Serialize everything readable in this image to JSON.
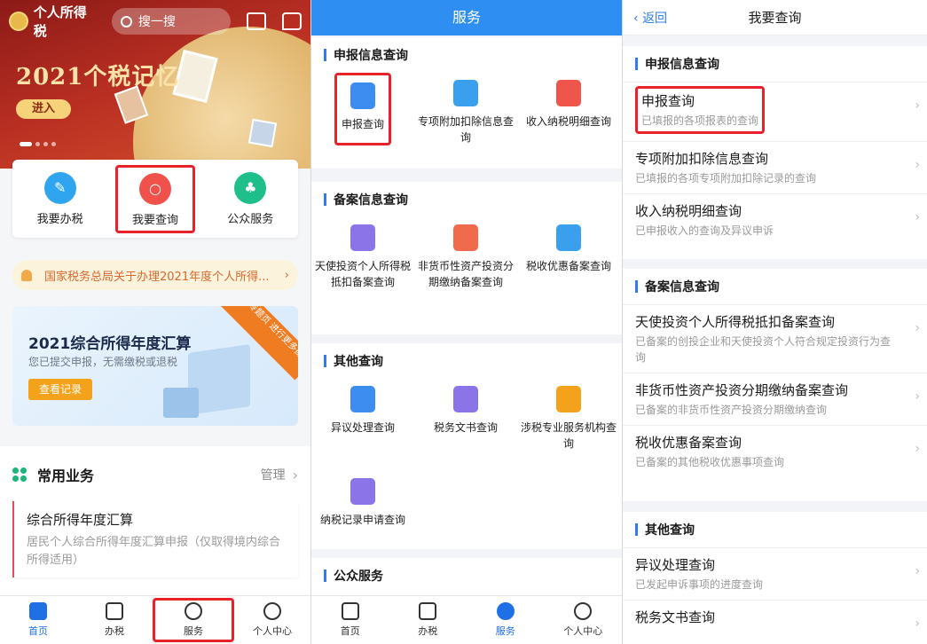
{
  "home": {
    "app_title": "个人所得税",
    "search_placeholder": "搜一搜",
    "promo_title": "2021个税记忆",
    "enter_label": "进入",
    "quick_actions": [
      {
        "label": "我要办税",
        "color": "#2fa4ef"
      },
      {
        "label": "我要查询",
        "color": "#f0514b"
      },
      {
        "label": "公众服务",
        "color": "#1fbf8b"
      }
    ],
    "notice_text": "国家税务总局关于办理2021年度个人所得...",
    "annual_card": {
      "title": "2021综合所得年度汇算",
      "subtitle": "您已提交申报，无需缴税或退税",
      "button": "查看记录",
      "ribbon": "进入专题页 进行更多操作"
    },
    "common": {
      "title": "常用业务",
      "manage": "管理",
      "item_title": "综合所得年度汇算",
      "item_desc": "居民个人综合所得年度汇算申报（仅取得境内综合所得适用）"
    }
  },
  "tabs": {
    "home": "首页",
    "tax": "办税",
    "service": "服务",
    "me": "个人中心"
  },
  "service": {
    "header": "服务",
    "sections": [
      {
        "title": "申报信息查询",
        "items": [
          "申报查询",
          "专项附加扣除信息查询",
          "收入纳税明细查询"
        ]
      },
      {
        "title": "备案信息查询",
        "items": [
          "天使投资个人所得税抵扣备案查询",
          "非货币性资产投资分期缴纳备案查询",
          "税收优惠备案查询"
        ]
      },
      {
        "title": "其他查询",
        "items": [
          "异议处理查询",
          "税务文书查询",
          "涉税专业服务机构查询",
          "纳税记录申请查询"
        ]
      },
      {
        "title": "公众服务",
        "items": []
      }
    ]
  },
  "query": {
    "back": "返回",
    "title": "我要查询",
    "sections": [
      {
        "title": "申报信息查询",
        "rows": [
          {
            "title": "申报查询",
            "desc": "已填报的各项报表的查询"
          },
          {
            "title": "专项附加扣除信息查询",
            "desc": "已填报的各项专项附加扣除记录的查询"
          },
          {
            "title": "收入纳税明细查询",
            "desc": "已申报收入的查询及异议申诉"
          }
        ]
      },
      {
        "title": "备案信息查询",
        "rows": [
          {
            "title": "天使投资个人所得税抵扣备案查询",
            "desc": "已备案的创投企业和天使投资个人符合规定投资行为查询"
          },
          {
            "title": "非货币性资产投资分期缴纳备案查询",
            "desc": "已备案的非货币性资产投资分期缴纳查询"
          },
          {
            "title": "税收优惠备案查询",
            "desc": "已备案的其他税收优惠事项查询"
          }
        ]
      },
      {
        "title": "其他查询",
        "rows": [
          {
            "title": "异议处理查询",
            "desc": "已发起申诉事项的进度查询"
          },
          {
            "title": "税务文书查询",
            "desc": ""
          }
        ]
      }
    ]
  },
  "colors": {
    "accent": "#2f7de8",
    "highlight": "#e8222a"
  }
}
